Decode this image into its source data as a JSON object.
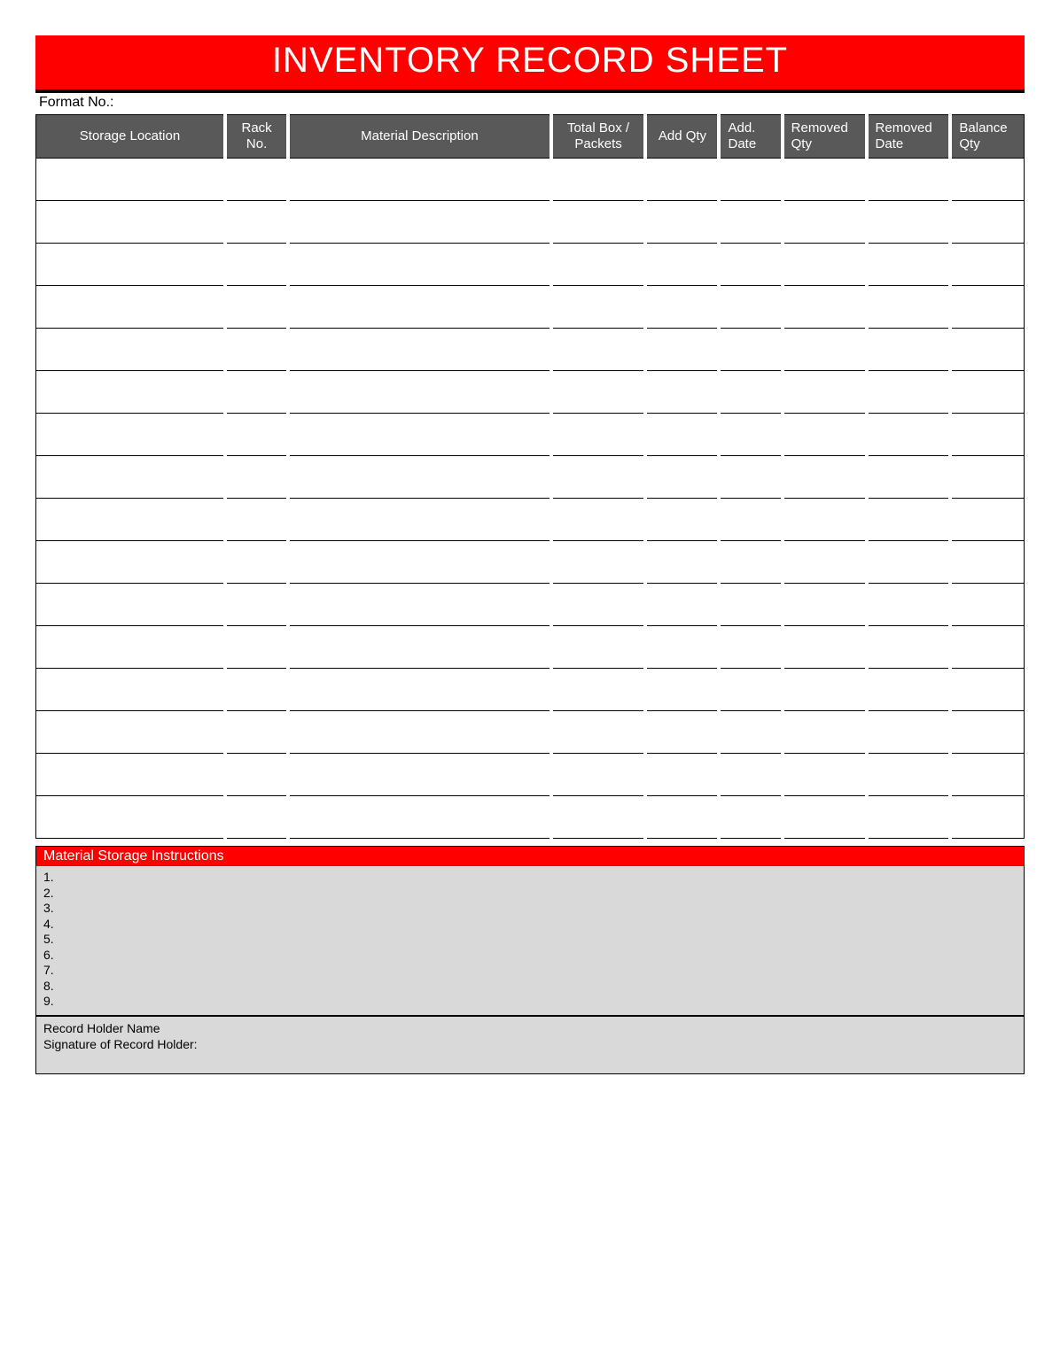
{
  "title": "INVENTORY RECORD SHEET",
  "format_label": "Format No.:",
  "columns": {
    "storage": "Storage Location",
    "rack": "Rack No.",
    "material": "Material Description",
    "totalbox": "Total Box / Packets",
    "addqty": "Add Qty",
    "adddate": "Add. Date",
    "remqty": "Removed Qty",
    "remdate": "Removed Date",
    "balance": "Balance Qty"
  },
  "row_count": 16,
  "instructions": {
    "header": "Material Storage Instructions",
    "items": [
      "1.",
      "2.",
      "3.",
      "4.",
      "5.",
      "6.",
      "7.",
      "8.",
      "9."
    ]
  },
  "signature": {
    "holder_name_label": "Record Holder Name",
    "signature_label": "Signature of Record Holder:"
  }
}
